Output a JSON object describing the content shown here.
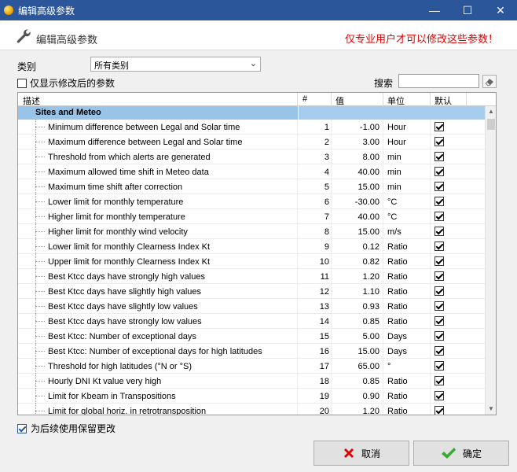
{
  "window": {
    "title": "编辑高级参数",
    "minimize": "—",
    "maximize": "☐",
    "close": "✕"
  },
  "header": {
    "title": "编辑高级参数",
    "warning": "仅专业用户才可以修改这些参数！"
  },
  "filters": {
    "category_label": "类别",
    "category_value": "所有类别",
    "modified_only_label": "仅显示修改后的参数",
    "modified_only_checked": false,
    "search_label": "搜索",
    "search_value": ""
  },
  "table": {
    "columns": {
      "desc": "描述",
      "num": "#",
      "value": "值",
      "unit": "单位",
      "default": "默认"
    },
    "group": "Sites and Meteo",
    "rows": [
      {
        "desc": "Minimum difference between Legal and Solar time",
        "num": "1",
        "value": "-1.00",
        "unit": "Hour"
      },
      {
        "desc": "Maximum difference between Legal and Solar time",
        "num": "2",
        "value": "3.00",
        "unit": "Hour"
      },
      {
        "desc": "Threshold from which alerts are generated",
        "num": "3",
        "value": "8.00",
        "unit": "min"
      },
      {
        "desc": "Maximum allowed time shift in Meteo data",
        "num": "4",
        "value": "40.00",
        "unit": "min"
      },
      {
        "desc": "Maximum time shift after correction",
        "num": "5",
        "value": "15.00",
        "unit": "min"
      },
      {
        "desc": "Lower limit for monthly temperature",
        "num": "6",
        "value": "-30.00",
        "unit": "°C"
      },
      {
        "desc": "Higher limit for monthly temperature",
        "num": "7",
        "value": "40.00",
        "unit": "°C"
      },
      {
        "desc": "Higher limit for monthly wind velocity",
        "num": "8",
        "value": "15.00",
        "unit": "m/s"
      },
      {
        "desc": "Lower limit for monthly Clearness Index Kt",
        "num": "9",
        "value": "0.12",
        "unit": "Ratio"
      },
      {
        "desc": "Upper limit for monthly Clearness Index Kt",
        "num": "10",
        "value": "0.82",
        "unit": "Ratio"
      },
      {
        "desc": "Best Ktcc days have strongly high values",
        "num": "11",
        "value": "1.20",
        "unit": "Ratio"
      },
      {
        "desc": "Best Ktcc days have slightly high values",
        "num": "12",
        "value": "1.10",
        "unit": "Ratio"
      },
      {
        "desc": "Best Ktcc days have slightly low values",
        "num": "13",
        "value": "0.93",
        "unit": "Ratio"
      },
      {
        "desc": "Best Ktcc days have strongly low values",
        "num": "14",
        "value": "0.85",
        "unit": "Ratio"
      },
      {
        "desc": "Best Ktcc: Number of exceptional days",
        "num": "15",
        "value": "5.00",
        "unit": "Days"
      },
      {
        "desc": " Best Ktcc: Number of exceptional days for high latitudes",
        "num": "16",
        "value": "15.00",
        "unit": "Days"
      },
      {
        "desc": " Threshold for high latitudes (°N or °S)",
        "num": "17",
        "value": "65.00",
        "unit": "°"
      },
      {
        "desc": " Hourly DNI Kt value very high",
        "num": "18",
        "value": "0.85",
        "unit": "Ratio"
      },
      {
        "desc": "Limit for Kbeam in Transpositions",
        "num": "19",
        "value": "0.90",
        "unit": "Ratio"
      },
      {
        "desc": "Limit for global horiz. in retrotransposition",
        "num": "20",
        "value": "1.20",
        "unit": "Ratio"
      }
    ]
  },
  "footer": {
    "keep_changes_label": "为后续使用保留更改",
    "keep_changes_checked": true,
    "cancel_label": "取消",
    "ok_label": "确定"
  },
  "colors": {
    "titlebar": "#2b579a",
    "group_row": "#99c4ea",
    "warning": "#e00000",
    "cancel_icon": "#e00000",
    "ok_icon": "#3aaa35"
  }
}
